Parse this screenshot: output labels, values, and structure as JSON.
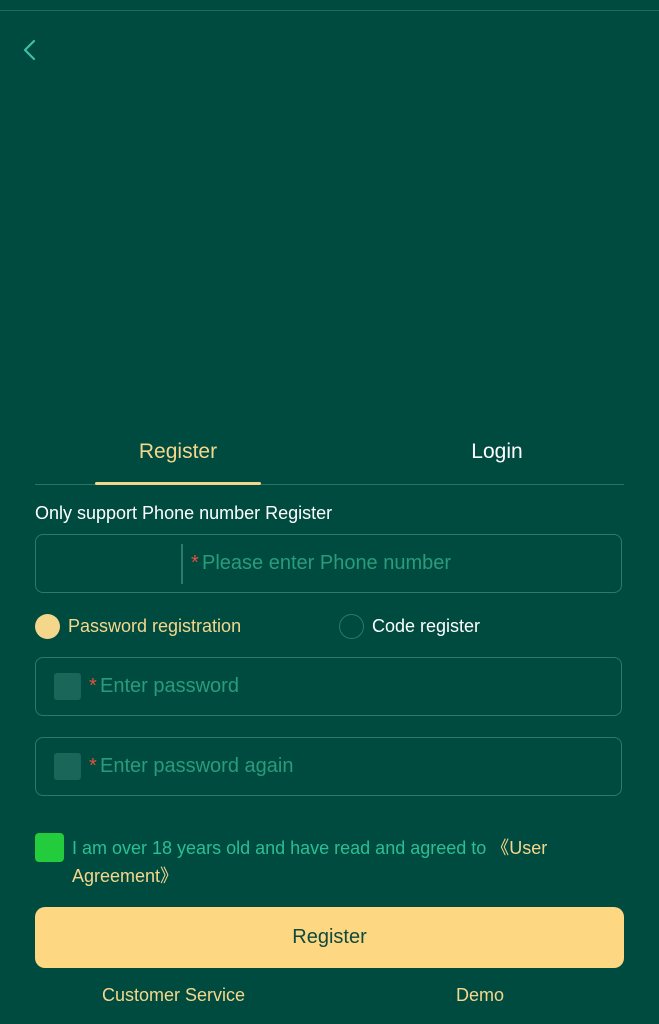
{
  "tabs": {
    "register_label": "Register",
    "login_label": "Login"
  },
  "form": {
    "hint": "Only support Phone number Register",
    "required_mark": "*",
    "phone_placeholder": "Please enter Phone number",
    "options": {
      "password_label": "Password registration",
      "code_label": "Code register",
      "selected": "Password registration"
    },
    "password_placeholder": "Enter password",
    "password_again_placeholder": "Enter password again"
  },
  "agreement": {
    "checked": true,
    "text": "I am over 18 years old and have read and agreed to ",
    "link_text": "《User Agreement》"
  },
  "register_button_label": "Register",
  "footer": {
    "customer_service": "Customer Service",
    "demo": "Demo"
  },
  "colors": {
    "background": "#004b40",
    "accent": "#f5d78c",
    "button": "#fdd782",
    "checkbox": "#22cc3c",
    "required": "#e0543a",
    "border": "#2b7a6a"
  },
  "icons": {
    "back": "chevron-left",
    "password_toggle": "eye-toggle"
  }
}
